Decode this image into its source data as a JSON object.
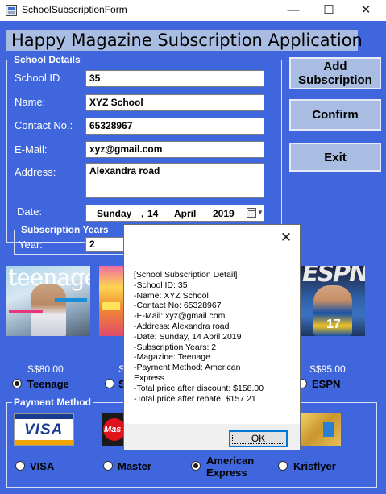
{
  "window": {
    "title": "SchoolSubscriptionForm",
    "minimize": "—",
    "maximize": "☐",
    "close": "✕"
  },
  "header": {
    "title": "Happy Magazine Subscription Application"
  },
  "school_details": {
    "legend": "School Details",
    "school_id_label": "School ID",
    "school_id_value": "35",
    "name_label": "Name:",
    "name_value": "XYZ School",
    "contact_label": "Contact No.:",
    "contact_value": "65328967",
    "email_label": "E-Mail:",
    "email_value": "xyz@gmail.com",
    "address_label": "Address:",
    "address_value": "Alexandra road",
    "date_label": "Date:",
    "date": {
      "weekday": "Sunday",
      "sep": ",",
      "day": "14",
      "month": "April",
      "year": "2019"
    }
  },
  "subscription_years": {
    "legend": "Subscription Years",
    "label": "Year:",
    "value": "2"
  },
  "buttons": {
    "add": "Add Subscription",
    "confirm": "Confirm",
    "exit": "Exit"
  },
  "magazines": [
    {
      "name": "Teenage",
      "price": "S$80.00",
      "selected": true,
      "cover_masthead": "teenage"
    },
    {
      "name": "S",
      "price": "S",
      "selected": false
    },
    {
      "name": "ESPN",
      "price": "S$95.00",
      "selected": false,
      "cover_masthead": "ESPN"
    }
  ],
  "payment": {
    "legend": "Payment Method",
    "options": [
      {
        "label": "VISA",
        "selected": false,
        "logo_text": "VISA"
      },
      {
        "label": "Master",
        "selected": false,
        "logo_text": "Mas"
      },
      {
        "label": "American Express",
        "line1": "American",
        "line2": "Express",
        "selected": true
      },
      {
        "label": "Krisflyer",
        "selected": false
      }
    ]
  },
  "dialog": {
    "close": "✕",
    "lines": [
      "[School Subscription Detail]",
      "-School ID: 35",
      "-Name: XYZ School",
      "-Contact No: 65328967",
      "-E-Mail: xyz@gmail.com",
      "-Address: Alexandra road",
      "-Date: Sunday, 14 April 2019",
      "-Subscription Years: 2",
      "-Magazine: Teenage",
      "-Payment Method: American",
      "Express",
      "-Total price after discount: $158.00",
      "-Total price after rebate: $157.21"
    ],
    "ok": "OK"
  },
  "colors": {
    "form_bg": "#3f66dc",
    "panel": "#a9bde2",
    "dialog_focus": "#0078d7"
  }
}
